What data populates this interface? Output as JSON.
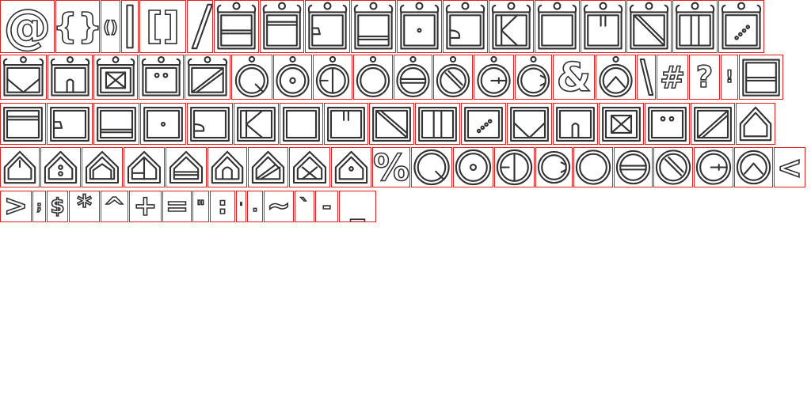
{
  "sheet": {
    "background": "#ffffff",
    "cell_border_color": "#e02020",
    "glyph_stroke_color": "#333333",
    "glyph_fill_color": "#ffffff",
    "rows": [
      [
        {
          "char": "@",
          "shape": "text"
        },
        {
          "char": "{}",
          "shape": "text"
        },
        {
          "char": "()",
          "shape": "text"
        },
        {
          "char": "|",
          "shape": "bar"
        },
        {
          "char": "[]",
          "shape": "text"
        },
        {
          "char": "/",
          "shape": "slash"
        },
        {
          "shape": "frame",
          "variant": "hline-mid"
        },
        {
          "shape": "frame",
          "variant": "hline-top"
        },
        {
          "shape": "frame",
          "variant": "notch-left"
        },
        {
          "shape": "frame",
          "variant": "double-bottom"
        },
        {
          "shape": "frame",
          "variant": "dot"
        },
        {
          "shape": "frame",
          "variant": "tail"
        },
        {
          "shape": "frame",
          "variant": "k"
        },
        {
          "shape": "frame",
          "variant": "plain"
        },
        {
          "shape": "frame",
          "variant": "v-notch"
        },
        {
          "shape": "frame",
          "variant": "diag-down"
        },
        {
          "shape": "frame",
          "variant": "double-vertical"
        },
        {
          "shape": "frame",
          "variant": "diag-dotted"
        }
      ],
      [
        {
          "shape": "frame",
          "variant": "check"
        },
        {
          "shape": "frame",
          "variant": "arch"
        },
        {
          "shape": "frame",
          "variant": "x"
        },
        {
          "shape": "frame",
          "variant": "two-dots"
        },
        {
          "shape": "frame",
          "variant": "diag-up"
        },
        {
          "shape": "ring",
          "variant": "q"
        },
        {
          "shape": "ring",
          "variant": "dot"
        },
        {
          "shape": "ring",
          "variant": "d"
        },
        {
          "shape": "ring",
          "variant": "plain"
        },
        {
          "shape": "ring",
          "variant": "bar"
        },
        {
          "shape": "ring",
          "variant": "slash"
        },
        {
          "shape": "ring",
          "variant": "e"
        },
        {
          "shape": "ring",
          "variant": "c"
        },
        {
          "char": "&",
          "shape": "text"
        },
        {
          "shape": "ring",
          "variant": "a"
        },
        {
          "char": "\\",
          "shape": "backslash"
        },
        {
          "char": "#",
          "shape": "text"
        },
        {
          "char": "?",
          "shape": "text"
        },
        {
          "char": "!",
          "shape": "text"
        },
        {
          "shape": "square",
          "variant": "hline-mid"
        }
      ],
      [
        {
          "shape": "square",
          "variant": "hline-top"
        },
        {
          "shape": "square",
          "variant": "notch-left"
        },
        {
          "shape": "square",
          "variant": "double-bottom"
        },
        {
          "shape": "square",
          "variant": "dot"
        },
        {
          "shape": "square",
          "variant": "tail"
        },
        {
          "shape": "square",
          "variant": "k"
        },
        {
          "shape": "square",
          "variant": "plain"
        },
        {
          "shape": "square",
          "variant": "v-notch"
        },
        {
          "shape": "square",
          "variant": "diag-down"
        },
        {
          "shape": "square",
          "variant": "double-vertical"
        },
        {
          "shape": "square",
          "variant": "diag-dotted"
        },
        {
          "shape": "square",
          "variant": "check"
        },
        {
          "shape": "square",
          "variant": "arch"
        },
        {
          "shape": "square",
          "variant": "x"
        },
        {
          "shape": "square",
          "variant": "two-dots"
        },
        {
          "shape": "square",
          "variant": "diag-up"
        },
        {
          "shape": "house",
          "variant": "plain"
        }
      ],
      [
        {
          "shape": "house",
          "variant": "tick"
        },
        {
          "shape": "house",
          "variant": "two-dots"
        },
        {
          "shape": "house",
          "variant": "inner"
        },
        {
          "shape": "house",
          "variant": "split"
        },
        {
          "shape": "house",
          "variant": "bar"
        },
        {
          "shape": "house",
          "variant": "arch"
        },
        {
          "shape": "house",
          "variant": "diag"
        },
        {
          "shape": "house",
          "variant": "x"
        },
        {
          "shape": "house",
          "variant": "dot"
        },
        {
          "char": "%",
          "shape": "text"
        },
        {
          "shape": "circle",
          "variant": "q"
        },
        {
          "shape": "circle",
          "variant": "dot"
        },
        {
          "shape": "circle",
          "variant": "d"
        },
        {
          "shape": "circle",
          "variant": "c"
        },
        {
          "shape": "circle",
          "variant": "plain"
        },
        {
          "shape": "circle",
          "variant": "bar"
        },
        {
          "shape": "circle",
          "variant": "slash"
        },
        {
          "shape": "circle",
          "variant": "e"
        },
        {
          "shape": "circle",
          "variant": "a"
        },
        {
          "char": "<",
          "shape": "text"
        }
      ],
      [
        {
          "char": ">",
          "shape": "text"
        },
        {
          "char": ";",
          "shape": "text"
        },
        {
          "char": "$",
          "shape": "text"
        },
        {
          "char": "*",
          "shape": "text"
        },
        {
          "char": "^",
          "shape": "text"
        },
        {
          "char": "+",
          "shape": "text"
        },
        {
          "char": "=",
          "shape": "text"
        },
        {
          "char": "\"",
          "shape": "text"
        },
        {
          "char": ":",
          "shape": "text"
        },
        {
          "char": "'",
          "shape": "text"
        },
        {
          "char": ".",
          "shape": "text"
        },
        {
          "char": "~",
          "shape": "text"
        },
        {
          "char": "`",
          "shape": "text"
        },
        {
          "char": "-",
          "shape": "text"
        },
        {
          "char": "_",
          "shape": "text"
        }
      ]
    ]
  }
}
